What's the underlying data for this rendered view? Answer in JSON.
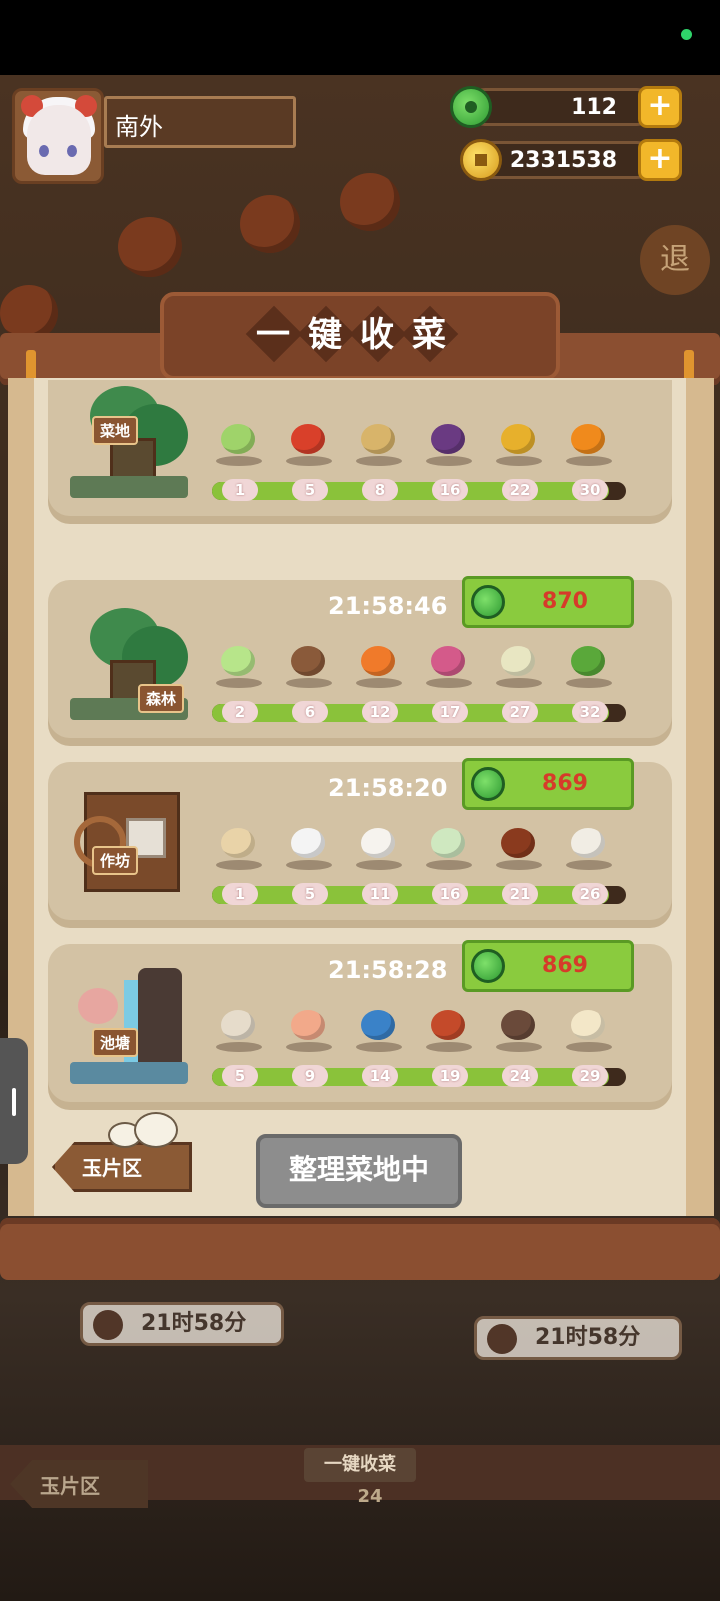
{
  "player": {
    "name": "南外"
  },
  "resources": {
    "jade": "112",
    "coins": "2331538"
  },
  "exit_label": "退",
  "panel_title": "一键收菜",
  "rows": [
    {
      "label": "菜地",
      "timer": "",
      "collect_value": "",
      "items": [
        "scallion",
        "chili",
        "potato",
        "eggplant",
        "corn",
        "pumpkin"
      ],
      "levels": [
        "1",
        "5",
        "8",
        "16",
        "22",
        "30"
      ],
      "progress": 0.96
    },
    {
      "label": "森林",
      "timer": "21:58:46",
      "collect_value": "870",
      "items": [
        "cabbage",
        "mushroom",
        "carrot",
        "radish",
        "bamboo-shoot",
        "herb"
      ],
      "levels": [
        "2",
        "6",
        "12",
        "17",
        "27",
        "32"
      ],
      "progress": 0.96
    },
    {
      "label": "作坊",
      "timer": "21:58:20",
      "collect_value": "869",
      "items": [
        "flour-sack",
        "rice-bowl",
        "tofu",
        "rice-leaf",
        "sauce-jar",
        "gravy"
      ],
      "levels": [
        "1",
        "5",
        "11",
        "16",
        "21",
        "26"
      ],
      "progress": 0.96
    },
    {
      "label": "池塘",
      "timer": "21:58:28",
      "collect_value": "869",
      "items": [
        "clam",
        "shrimp",
        "fish",
        "crab-meat",
        "crab",
        "shell"
      ],
      "levels": [
        "5",
        "9",
        "14",
        "19",
        "24",
        "29"
      ],
      "progress": 0.96
    }
  ],
  "jade_area_label": "玉片区",
  "organize_button": "整理菜地中",
  "background": {
    "timer_left": "21时58分",
    "timer_right": "21时58分",
    "collect_label": "一键收菜",
    "collect_count": "24",
    "jade_area_label": "玉片区"
  }
}
